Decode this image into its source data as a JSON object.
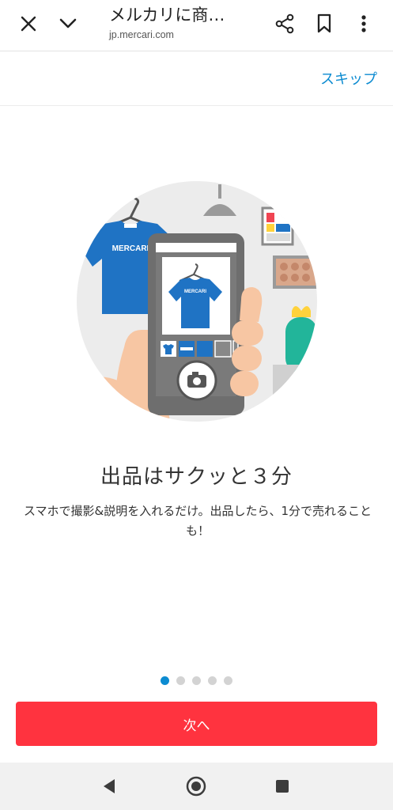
{
  "browser": {
    "title": "メルカリに商…",
    "url": "jp.mercari.com",
    "icons": [
      "close-icon",
      "chevron-down-icon",
      "share-icon",
      "bookmark-icon",
      "more-vertical-icon"
    ]
  },
  "onboarding": {
    "skip_label": "スキップ",
    "illustration": {
      "shirt_brand": "MERCARI",
      "icons": [
        "hanger-icon",
        "camera-icon",
        "close-icon"
      ]
    },
    "headline": "出品はサクッと３分",
    "description": "スマホで撮影&説明を入れるだけ。出品したら、1分で売れることも！",
    "pagination": {
      "total": 5,
      "current": 1
    },
    "next_label": "次へ"
  },
  "system_nav": {
    "icons": [
      "back-icon",
      "home-icon",
      "recents-icon"
    ]
  },
  "colors": {
    "accent_blue": "#0c8bd1",
    "primary_red": "#ff333f",
    "shirt_blue": "#1f73c4"
  }
}
